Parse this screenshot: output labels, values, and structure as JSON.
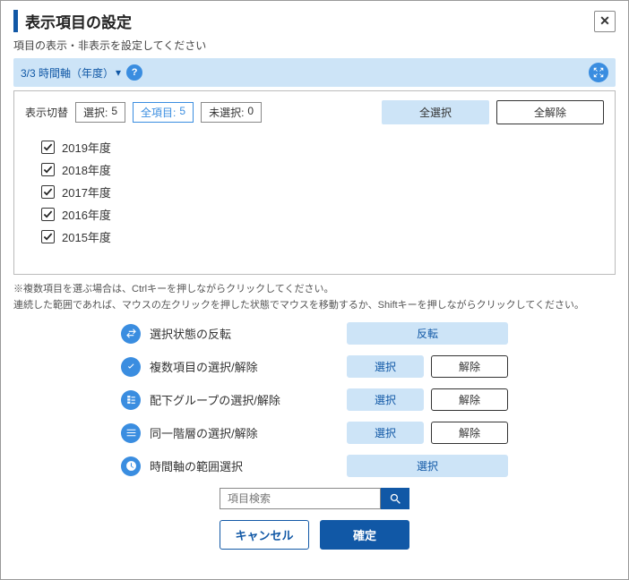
{
  "dialog": {
    "title": "表示項目の設定",
    "subtitle": "項目の表示・非表示を設定してください"
  },
  "tab": {
    "selected": "3/3 時間軸（年度）"
  },
  "toolbar": {
    "switch_label": "表示切替",
    "selected_label": "選択:",
    "selected_count": "5",
    "all_label": "全項目:",
    "all_count": "5",
    "unselected_label": "未選択:",
    "unselected_count": "0",
    "select_all": "全選択",
    "deselect_all": "全解除"
  },
  "years": [
    {
      "label": "2019年度",
      "checked": true
    },
    {
      "label": "2018年度",
      "checked": true
    },
    {
      "label": "2017年度",
      "checked": true
    },
    {
      "label": "2016年度",
      "checked": true
    },
    {
      "label": "2015年度",
      "checked": true
    }
  ],
  "hints": {
    "line1": "※複数項目を選ぶ場合は、Ctrlキーを押しながらクリックしてください。",
    "line2": "連続した範囲であれば、マウスの左クリックを押した状態でマウスを移動するか、Shiftキーを押しながらクリックしてください。"
  },
  "actions": {
    "invert": "選択状態の反転",
    "invert_btn": "反転",
    "multi": "複数項目の選択/解除",
    "group": "配下グループの選択/解除",
    "same_level": "同一階層の選択/解除",
    "time_range": "時間軸の範囲選択",
    "select_btn": "選択",
    "deselect_btn": "解除"
  },
  "search": {
    "placeholder": "項目検索"
  },
  "footer": {
    "cancel": "キャンセル",
    "confirm": "確定"
  }
}
